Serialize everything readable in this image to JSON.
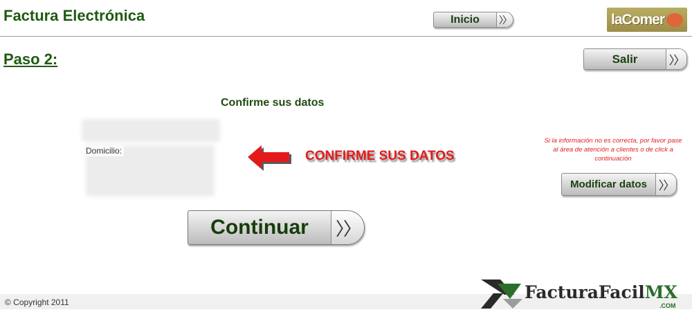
{
  "header": {
    "title": "Factura Electrónica",
    "inicio_label": "Inicio",
    "brand_logo": "laComer"
  },
  "step": {
    "title": "Paso 2:",
    "salir_label": "Salir"
  },
  "confirm": {
    "title": "Confirme sus datos",
    "domicilio_label": "Domicilio:",
    "callout": "CONFIRME SUS DATOS",
    "continuar_label": "Continuar"
  },
  "side": {
    "notice": "Si la información no es correcta, por favor pase al área de atención a clientes o de click a continuación",
    "modificar_label": "Modificar datos"
  },
  "footer": {
    "copyright": "© Copyright 2011",
    "brand_main": "FacturaFacil",
    "brand_mx": "MX",
    "brand_domain": ".COM"
  },
  "icons": {
    "arrow": "chevron-double-right-icon",
    "callout_arrow": "red-left-arrow-icon"
  },
  "colors": {
    "title_green": "#1e5a12",
    "callout_red": "#e41a1a",
    "notice_red": "#e02020",
    "brand_green": "#2b6e2a"
  }
}
